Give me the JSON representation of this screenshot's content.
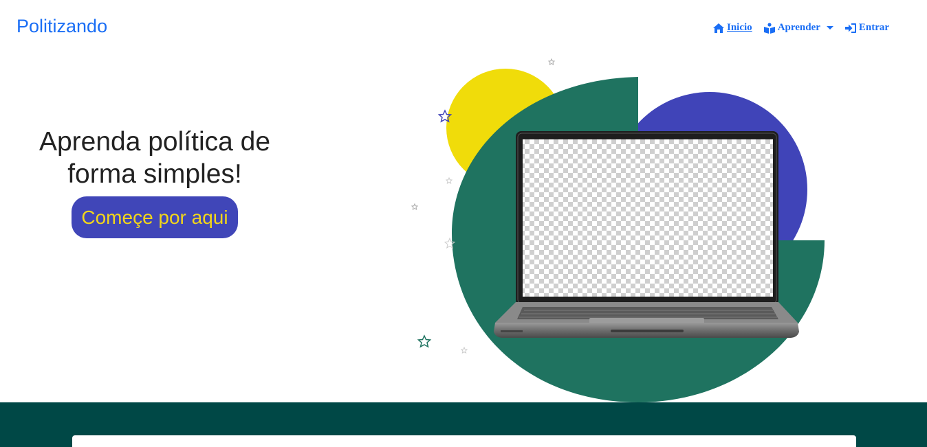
{
  "navbar": {
    "brand": "Politizando",
    "items": [
      {
        "label": "Inicio",
        "icon": "home-icon",
        "active": true
      },
      {
        "label": "Aprender",
        "icon": "book-reader-icon",
        "dropdown": true
      },
      {
        "label": "Entrar",
        "icon": "sign-in-icon"
      }
    ]
  },
  "hero": {
    "title_line1": "Aprenda política de",
    "title_line2": "forma simples!",
    "cta_label": "Começe por aqui"
  },
  "colors": {
    "brand_blue": "#1a6ef5",
    "cta_bg": "#4046b8",
    "cta_text": "#f2d61a",
    "green": "#1f7360",
    "yellow": "#f0dc0a",
    "indigo": "#4044b8",
    "footer_band": "#004846"
  }
}
